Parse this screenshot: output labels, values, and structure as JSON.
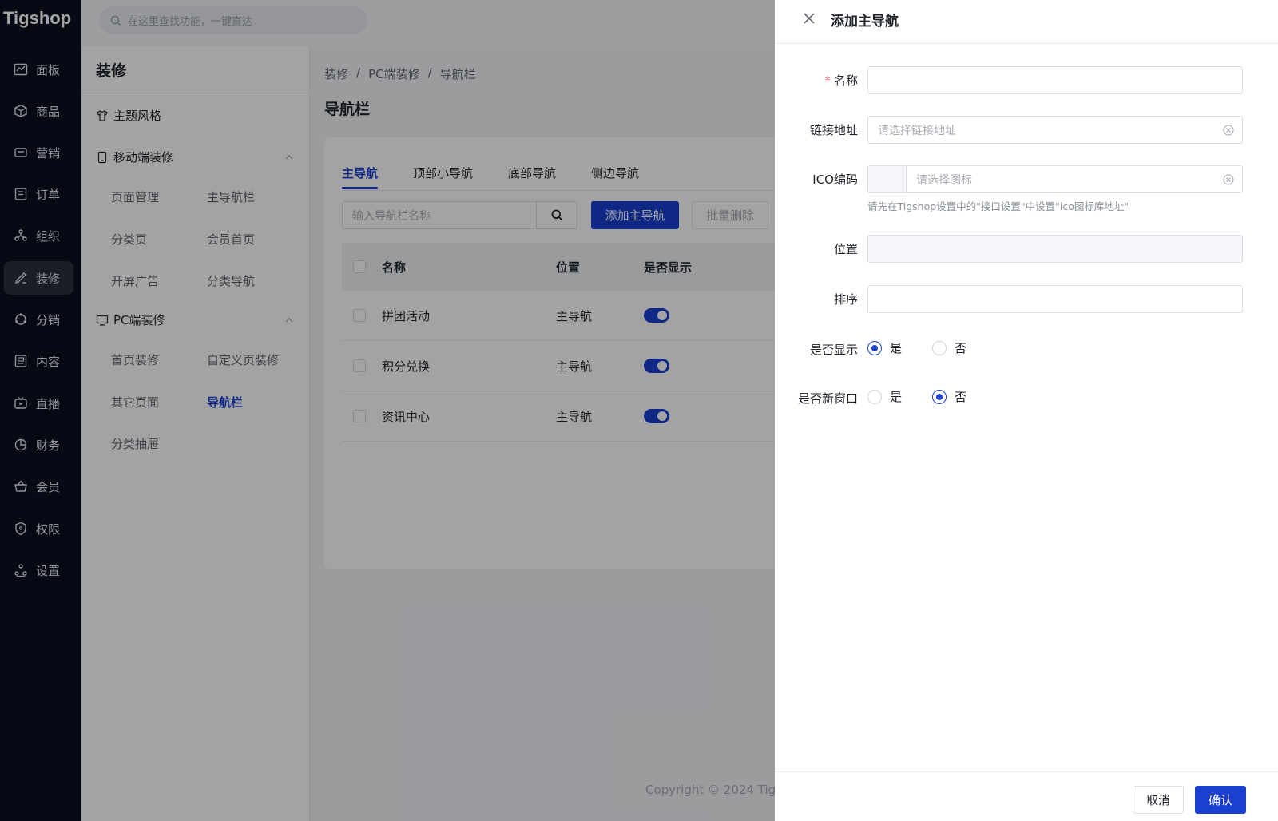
{
  "app": {
    "logo": "Tigshop"
  },
  "topbar": {
    "search_placeholder": "在这里查找功能，一键直达"
  },
  "rail": {
    "items": [
      {
        "label": "面板",
        "icon": "chart-icon"
      },
      {
        "label": "商品",
        "icon": "box-icon"
      },
      {
        "label": "营销",
        "icon": "megaphone-icon"
      },
      {
        "label": "订单",
        "icon": "order-icon"
      },
      {
        "label": "组织",
        "icon": "org-icon"
      },
      {
        "label": "装修",
        "icon": "brush-icon",
        "active": true
      },
      {
        "label": "分销",
        "icon": "share-icon"
      },
      {
        "label": "内容",
        "icon": "content-icon"
      },
      {
        "label": "直播",
        "icon": "live-icon"
      },
      {
        "label": "财务",
        "icon": "pie-icon"
      },
      {
        "label": "会员",
        "icon": "basket-icon"
      },
      {
        "label": "权限",
        "icon": "shield-icon"
      },
      {
        "label": "设置",
        "icon": "settings-icon"
      }
    ]
  },
  "submenu": {
    "title": "装修",
    "theme": "主题风格",
    "mobile": {
      "label": "移动端装修",
      "links": [
        "页面管理",
        "主导航栏",
        "分类页",
        "会员首页",
        "开屏广告",
        "分类导航"
      ]
    },
    "pc": {
      "label": "PC端装修",
      "links": [
        "首页装修",
        "自定义页装修",
        "其它页面",
        "导航栏",
        "分类抽屉"
      ],
      "active": "导航栏"
    }
  },
  "main": {
    "breadcrumb": [
      "装修",
      "/",
      "PC端装修",
      "/",
      "导航栏"
    ],
    "title": "导航栏",
    "tabs": [
      "主导航",
      "顶部小导航",
      "底部导航",
      "侧边导航"
    ],
    "search_placeholder": "输入导航栏名称",
    "add_button": "添加主导航",
    "batch_delete": "批量删除",
    "columns": [
      "名称",
      "位置",
      "是否显示"
    ],
    "rows": [
      {
        "name": "拼团活动",
        "position": "主导航",
        "show": true
      },
      {
        "name": "积分兑换",
        "position": "主导航",
        "show": true
      },
      {
        "name": "资讯中心",
        "position": "主导航",
        "show": true
      }
    ],
    "copyright": "Copyright © 2024 Tig"
  },
  "drawer": {
    "title": "添加主导航",
    "fields": {
      "name_label": "名称",
      "name_value": "",
      "link_label": "链接地址",
      "link_placeholder": "请选择链接地址",
      "ico_label": "ICO编码",
      "ico_placeholder": "请选择图标",
      "ico_hint": "请先在Tigshop设置中的\"接口设置\"中设置\"ico图标库地址\"",
      "position_label": "位置",
      "position_value": "",
      "sort_label": "排序",
      "sort_value": "",
      "show_label": "是否显示",
      "newwin_label": "是否新窗口",
      "yes": "是",
      "no": "否"
    },
    "show_selected": "是",
    "newwin_selected": "否",
    "cancel": "取消",
    "confirm": "确认"
  },
  "colors": {
    "primary": "#1a3fd1",
    "rail_bg": "#0b1020"
  }
}
